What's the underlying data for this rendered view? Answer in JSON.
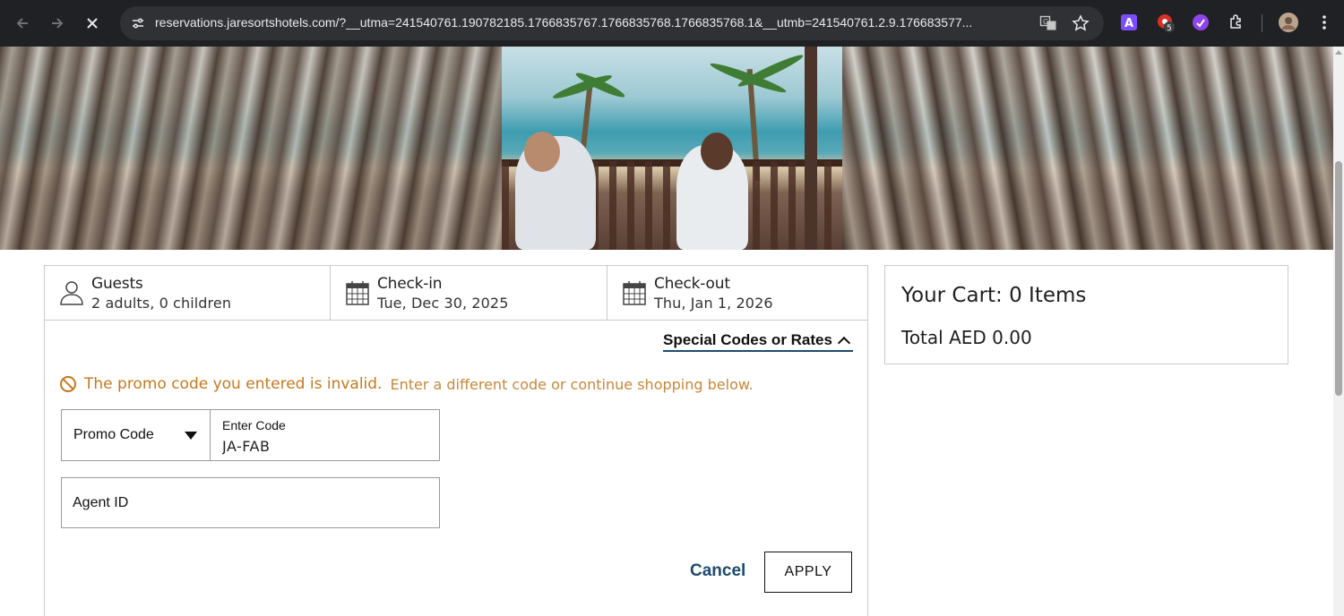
{
  "browser": {
    "url": "reservations.jaresortshotels.com/?__utma=241540761.190782185.1766835767.1766835768.1766835768.1&__utmb=241540761.2.9.176683577...",
    "extension_badge_count": "5",
    "icons": [
      "back-icon",
      "forward-icon",
      "stop-loading-icon",
      "site-info-icon",
      "translate-icon",
      "bookmark-star-icon",
      "extensions-puzzle-icon",
      "profile-avatar",
      "menu-kebab-icon"
    ]
  },
  "search": {
    "guests": {
      "title": "Guests",
      "value": "2 adults, 0 children"
    },
    "checkin": {
      "title": "Check-in",
      "value": "Tue, Dec 30, 2025"
    },
    "checkout": {
      "title": "Check-out",
      "value": "Thu, Jan 1, 2026"
    }
  },
  "special_codes": {
    "toggle_label": "Special Codes or Rates",
    "error_strong": "The promo code you entered is invalid.",
    "error_detail": "Enter a different code or continue shopping below.",
    "promo_type": "Promo Code",
    "code_label": "Enter Code",
    "code_value": "JA-FAB",
    "agent_placeholder": "Agent ID",
    "cancel_label": "Cancel",
    "apply_label": "APPLY"
  },
  "cart": {
    "title": "Your Cart: 0 Items",
    "total": "Total AED 0.00"
  },
  "colors": {
    "warning": "#c6781d",
    "link": "#1d4a6f",
    "chrome_bg": "#202124"
  }
}
